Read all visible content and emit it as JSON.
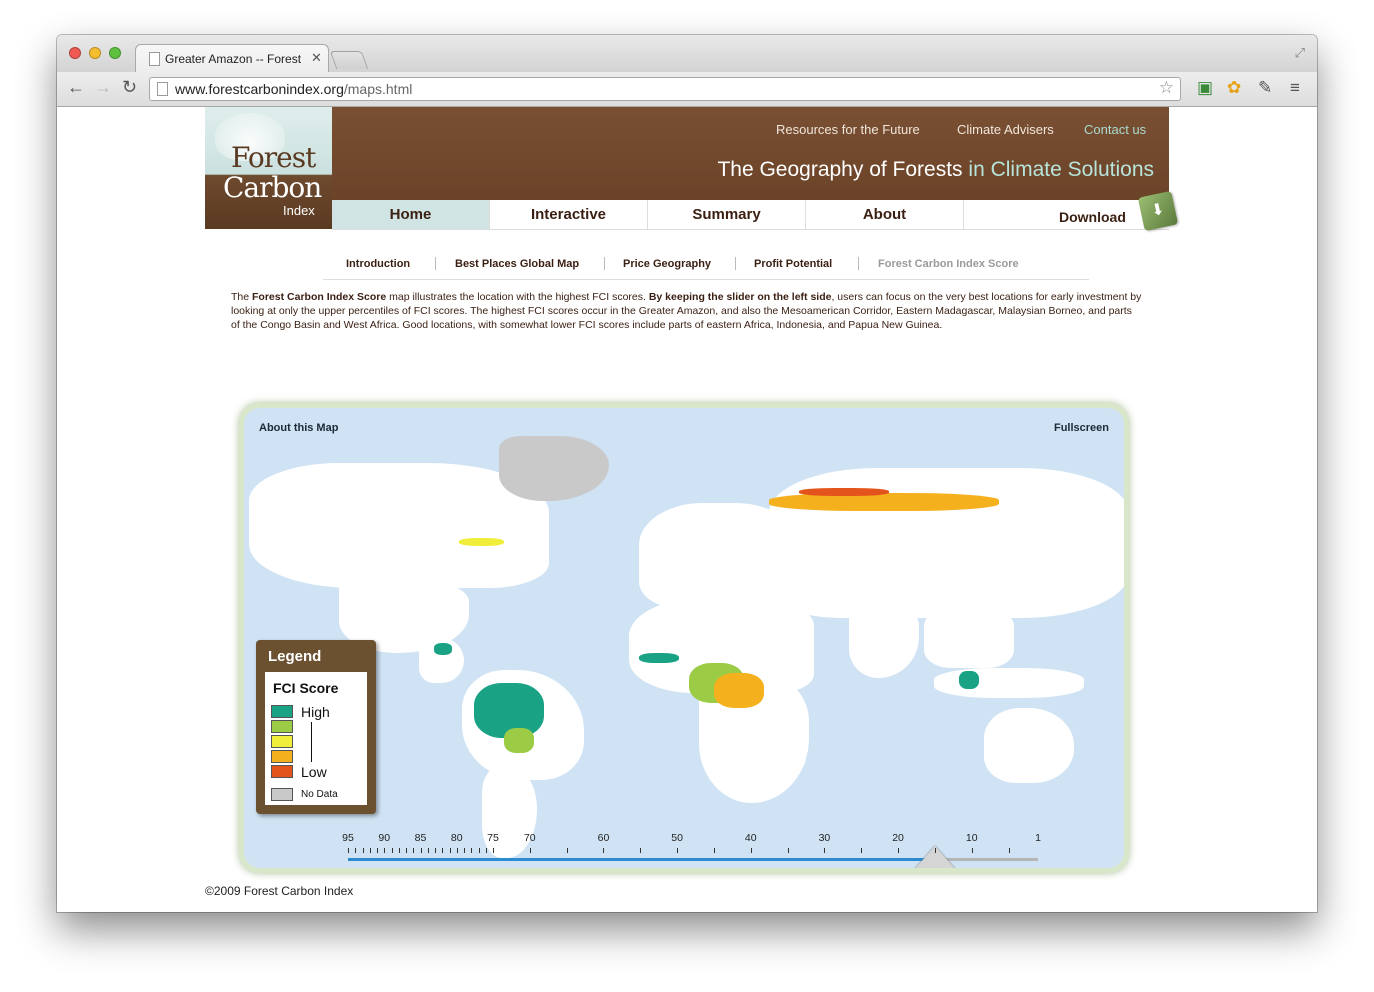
{
  "browser": {
    "tab_title": "Greater Amazon -- Forest",
    "url_domain": "www.forestcarbonindex.org",
    "url_path": "/maps.html",
    "back_icon": "←",
    "forward_icon": "→",
    "reload_icon": "↻",
    "close_tab_icon": "✕"
  },
  "logo": {
    "line1": "Forest",
    "line2": "Carbon",
    "line3": "Index"
  },
  "header": {
    "links": [
      "Resources for the Future",
      "Climate Advisers",
      "Contact us"
    ],
    "tagline_main": "The Geography of Forests",
    "tagline_accent": "in Climate Solutions"
  },
  "nav": {
    "items": [
      "Home",
      "Interactive",
      "Summary",
      "About"
    ],
    "download": "Download"
  },
  "subnav": [
    "Introduction",
    "Best Places Global Map",
    "Price Geography",
    "Profit Potential",
    "Forest Carbon Index Score"
  ],
  "intro": {
    "p1": "The ",
    "b1": "Forest Carbon Index Score",
    "p2": " map illustrates the location with the highest FCI scores. ",
    "b2": "By keeping the slider on the left side",
    "p3": ", users can focus on the very best locations for early investment by looking at only the upper percentiles of FCI scores. The highest FCI scores occur in the Greater Amazon, and also the Mesoamerican Corridor, Eastern Madagascar, Malaysian Borneo, and parts of the Congo Basin and West Africa. Good locations, with somewhat lower FCI scores include parts of eastern Africa, Indonesia, and Papua New Guinea."
  },
  "map": {
    "about_link": "About this Map",
    "fullscreen_link": "Fullscreen",
    "legend_title": "Legend",
    "legend_subtitle": "FCI Score",
    "legend_high": "High",
    "legend_low": "Low",
    "legend_nodata": "No Data",
    "legend_colors": [
      "#1aa285",
      "#9ccc46",
      "#f0ee3a",
      "#f5b01e",
      "#e2541b"
    ],
    "nodata_color": "#c9c9c9",
    "slider_ticks": [
      "95",
      "90",
      "85",
      "80",
      "75",
      "70",
      "60",
      "50",
      "40",
      "30",
      "20",
      "10",
      "1"
    ],
    "slider_value": 15
  },
  "footer": "©2009 Forest Carbon Index"
}
